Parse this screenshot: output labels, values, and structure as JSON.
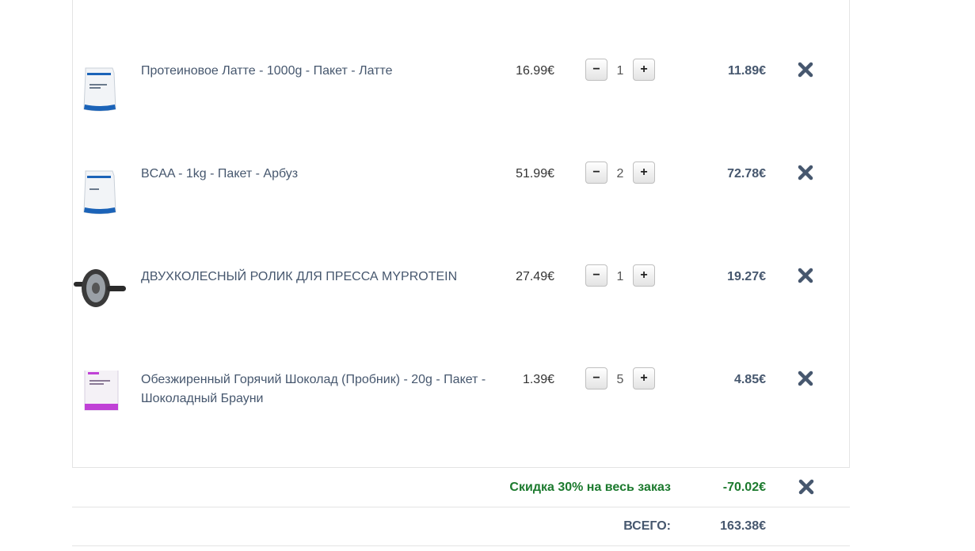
{
  "cart": {
    "items": [
      {
        "name": "Протеиновое Латте - 1000g - Пакет - Латте",
        "price": "16.99€",
        "quantity": "1",
        "total": "11.89€",
        "image": "white-protein-pouch",
        "accent": "#1b63b8"
      },
      {
        "name": "BCAA - 1kg - Пакет - Арбуз",
        "price": "51.99€",
        "quantity": "2",
        "total": "72.78€",
        "image": "white-protein-pouch",
        "accent": "#1b63b8"
      },
      {
        "name": "ДВУХКОЛЕСНЫЙ РОЛИК ДЛЯ ПРЕССА MYPROTEIN",
        "price": "27.49€",
        "quantity": "1",
        "total": "19.27€",
        "image": "ab-wheel-roller",
        "accent": "#2b2b2b"
      },
      {
        "name": "Обезжиренный Горячий Шоколад (Пробник) - 20g - Пакет - Шоколадный Брауни",
        "price": "1.39€",
        "quantity": "5",
        "total": "4.85€",
        "image": "sample-sachet",
        "accent": "#c041d6"
      }
    ],
    "controls": {
      "minus_symbol": "−",
      "plus_symbol": "+",
      "remove_icon": "x-icon"
    }
  },
  "summary": {
    "discount_label": "Скидка 30% на весь заказ",
    "discount_amount": "-70.02€",
    "total_label": "ВСЕГО:",
    "total_amount": "163.38€"
  },
  "colors": {
    "text": "#46576e",
    "discount_green": "#1c7a2e",
    "border": "#e4e4e4",
    "remove_icon": "#46576e"
  }
}
